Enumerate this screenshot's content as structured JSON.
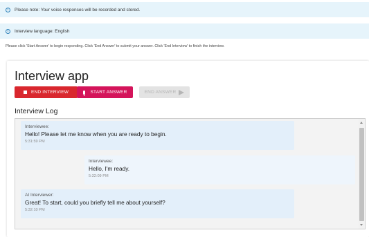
{
  "notices": [
    {
      "text": "Please note: Your voice responses will be recorded and stored."
    },
    {
      "text": "Interview language: English"
    }
  ],
  "instructions": "Please click 'Start Answer' to begin responding. Click 'End Answer' to submit your answer. Click 'End Interview' to finish the interview.",
  "app": {
    "title": "Interview app",
    "buttons": {
      "end_interview": "END INTERVIEW",
      "start_answer": "START ANSWER",
      "end_answer": "END ANSWER"
    },
    "log_title": "Interview Log"
  },
  "log": [
    {
      "role": "Interviewee:",
      "text": "Hello! Please let me know when you are ready to begin.",
      "time": "5:31:59 PM"
    },
    {
      "role": "Interviewee:",
      "text": "Hello, I'm ready.",
      "time": "5:32:09 PM"
    },
    {
      "role": "AI Interviewer:",
      "text": "Great! To start, could you briefly tell me about yourself?",
      "time": "5:32:10 PM"
    }
  ],
  "icons": {
    "info": "info-circle-icon",
    "stop": "stop-icon",
    "mic": "microphone-icon",
    "send": "send-arrow-icon"
  },
  "colors": {
    "notice_bg": "#e6f4fb",
    "end_interview": "#d9272e",
    "start_answer": "#d4145a",
    "disabled": "#e3e3e3",
    "message_bg": "#e3effa"
  }
}
